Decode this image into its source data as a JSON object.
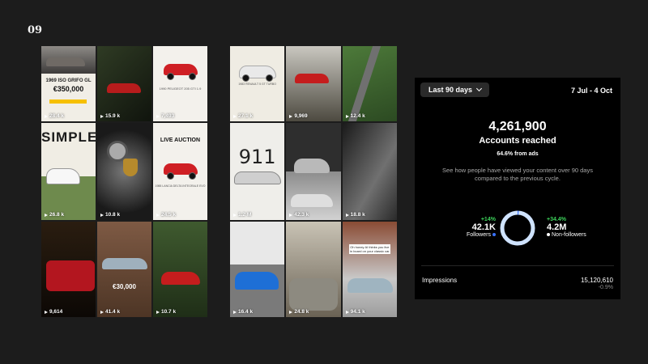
{
  "slide_number": "09",
  "grid_a": [
    {
      "views": "28.4 k",
      "caption": "1969 ISO GRIFO GL",
      "price": "€350,000"
    },
    {
      "views": "15.9 k"
    },
    {
      "views": "7,493",
      "caption": "1990 PEUGEOT 205 GTI 1.9"
    },
    {
      "views": "26.8 k",
      "caption": "SIMPLE"
    },
    {
      "views": "10.8 k"
    },
    {
      "views": "24.5 k",
      "caption": "LIVE AUCTION",
      "sub": "1988 LANCIA DELTA INTEGRALE EVO"
    },
    {
      "views": "9,614"
    },
    {
      "views": "41.4 k",
      "price": "€30,000"
    },
    {
      "views": "10.7 k"
    }
  ],
  "grid_b": [
    {
      "views": "27.1 k",
      "caption": "1983 RENAULT 5 GT TURBO"
    },
    {
      "views": "9,969"
    },
    {
      "views": "12.4 k"
    },
    {
      "views": "1.2 M",
      "caption": "911"
    },
    {
      "views": "42.3 k"
    },
    {
      "views": "18.8 k"
    },
    {
      "views": "16.4 k"
    },
    {
      "views": "24.8 k"
    },
    {
      "views": "94.1 k",
      "caption": "Oh honey AI thinks you live in board on your classic car"
    }
  ],
  "insights": {
    "range": "Last 90 days",
    "dates": "7 Jul - 4 Oct",
    "accounts": "4,261,900",
    "accounts_label": "Accounts reached",
    "from_ads": "64.6% from ads",
    "description": "See how people have viewed your content over 90 days compared to the previous cycle.",
    "followers": {
      "pct": "+14%",
      "value": "42.1K",
      "label": "Followers",
      "share": 0.01
    },
    "non_followers": {
      "pct": "+34.4%",
      "value": "4.2M",
      "label": "Non-followers"
    },
    "impressions_label": "Impressions",
    "impressions_value": "15,120,610",
    "impressions_delta": "-0.9%",
    "colors": {
      "followers": "#3a73ff",
      "non_followers": "#cfe3ff",
      "positive": "#3cd15a"
    }
  }
}
